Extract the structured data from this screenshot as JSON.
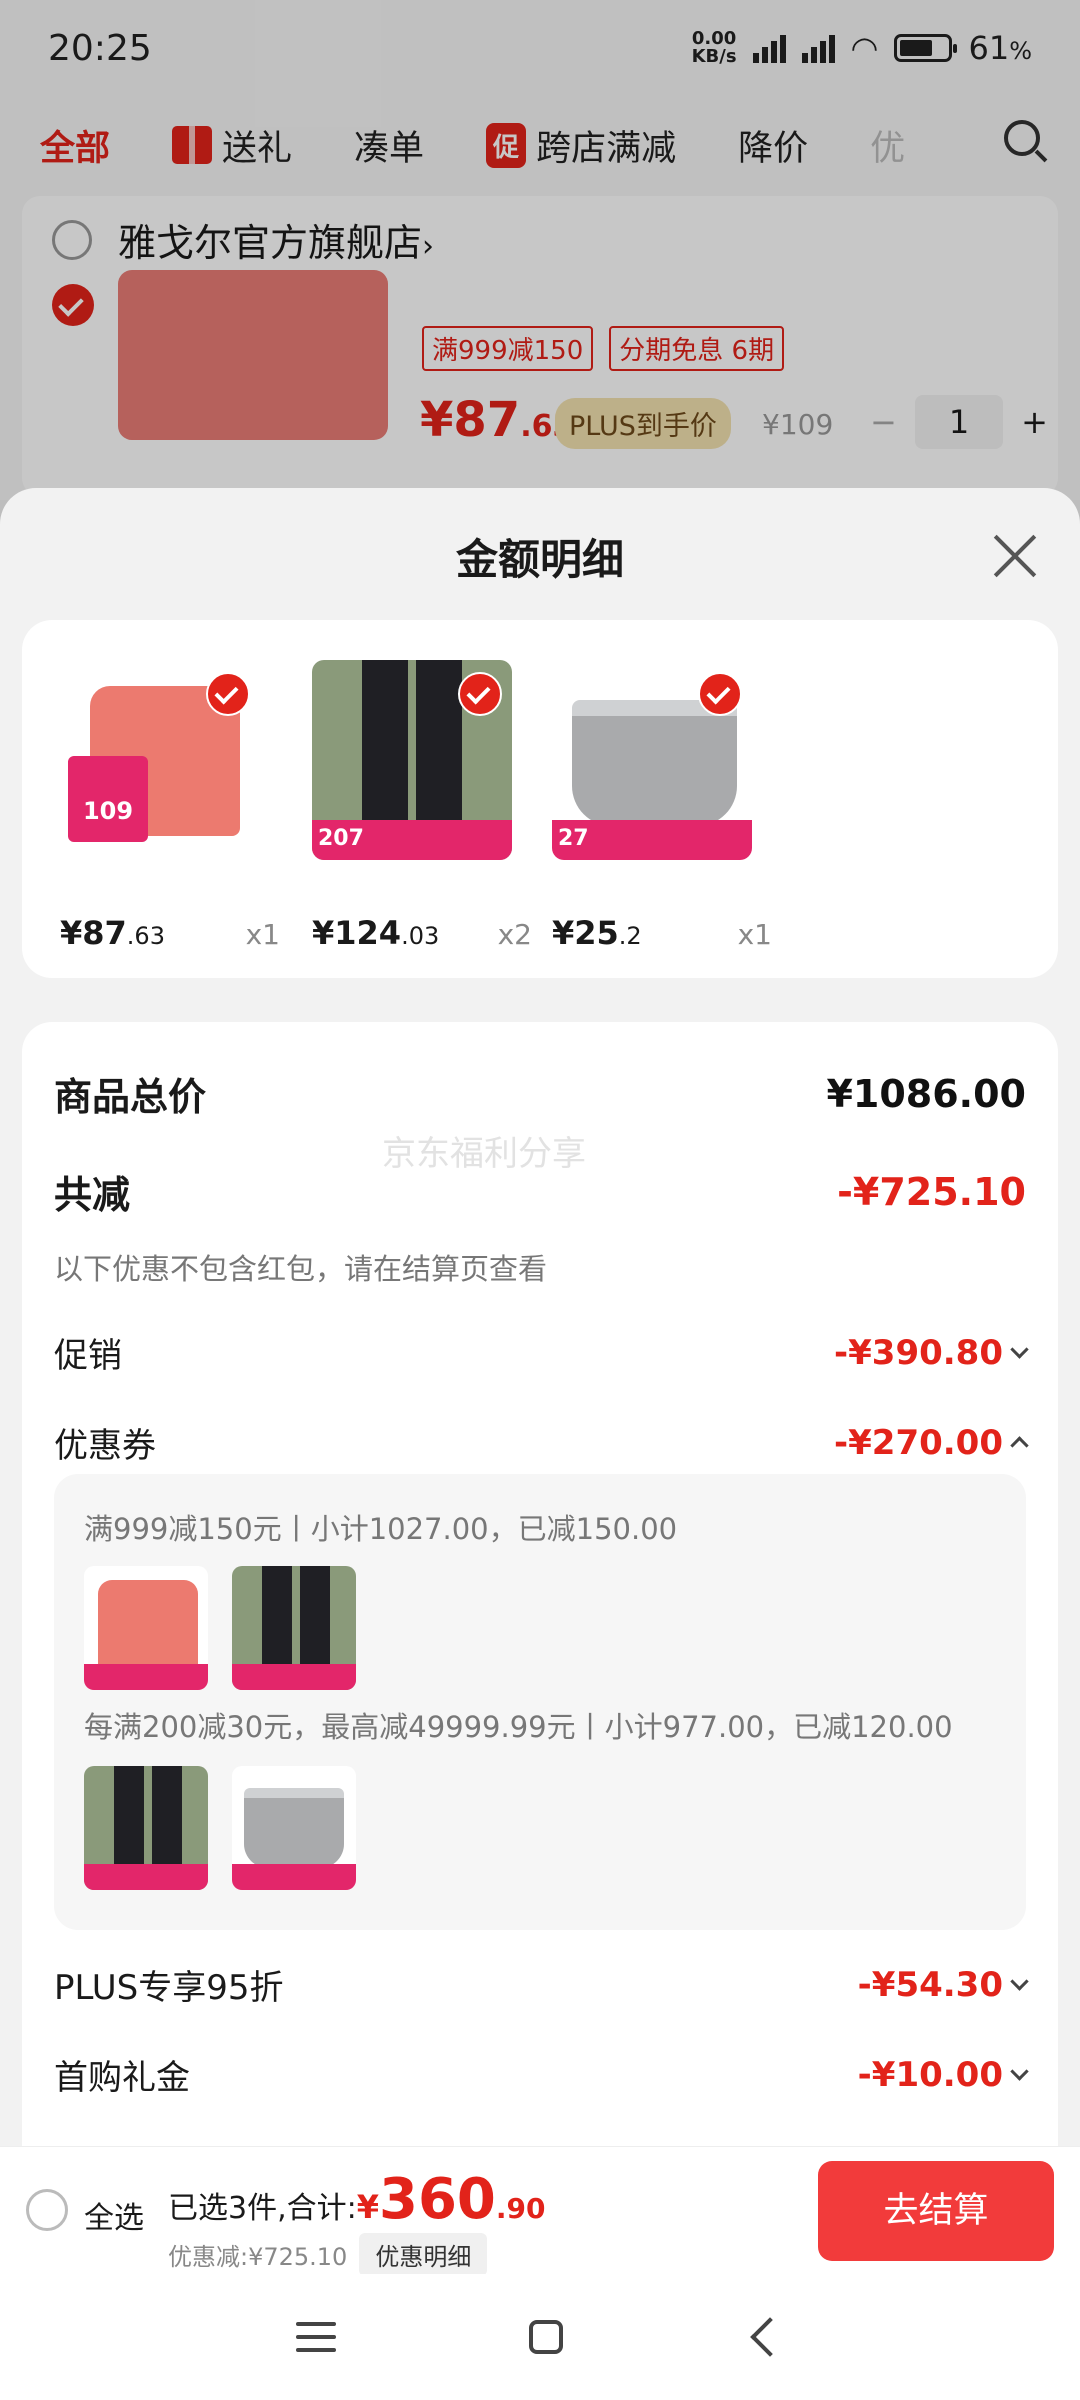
{
  "status": {
    "time": "20:25",
    "net_speed_top": "0.00",
    "net_speed_bottom": "KB/s",
    "battery": "61",
    "battery_unit": "%"
  },
  "tabs": [
    {
      "label": "全部"
    },
    {
      "label": "送礼"
    },
    {
      "label": "凑单"
    },
    {
      "label": "跨店满减",
      "badge": "促"
    },
    {
      "label": "降价"
    },
    {
      "label": "优"
    }
  ],
  "background_cart": {
    "store_name": "雅戈尔官方旗舰店",
    "store_chevron": "›",
    "tag1": "满999减150",
    "tag2_a": "分期免息",
    "tag2_b": "6期",
    "price_int": "¥87",
    "price_dec": ".63",
    "plus_label": "PLUS到手价",
    "orig_price": "¥109",
    "qty": "1",
    "minus": "−",
    "plus": "+"
  },
  "sheet": {
    "title": "金额明细",
    "products": [
      {
        "price_int": "¥87",
        "price_dec": ".63",
        "qty": "x1",
        "badge": "109",
        "type": "tshirt"
      },
      {
        "price_int": "¥124",
        "price_dec": ".03",
        "qty": "x2",
        "badge": "207",
        "type": "pants"
      },
      {
        "price_int": "¥25",
        "price_dec": ".2",
        "qty": "x1",
        "badge": "27",
        "type": "shorts"
      }
    ],
    "summary": {
      "total_label": "商品总价",
      "total_value": "¥1086.00",
      "watermark": "京东福利分享",
      "reduce_label": "共减",
      "reduce_value": "-¥725.10",
      "note": "以下优惠不包含红包，请在结算页查看",
      "promo_label": "促销",
      "promo_value": "-¥390.80",
      "coupon_label": "优惠券",
      "coupon_value": "-¥270.00",
      "coupon_line1": "满999减150元丨小计1027.00，已减150.00",
      "coupon_line2": "每满200减30元，最高减49999.99元丨小计977.00，已减120.00",
      "plus_label": "PLUS专享95折",
      "plus_value": "-¥54.30",
      "gift_label": "首购礼金",
      "gift_value": "-¥10.00"
    }
  },
  "bottom": {
    "select_all": "全选",
    "selected_text": "已选3件,合计:",
    "yen": "¥",
    "total_int": "360",
    "total_dec": ".90",
    "discount_text": "优惠减:¥725.10",
    "discount_btn": "优惠明细",
    "checkout": "去结算"
  },
  "colors": {
    "accent": "#e2231a",
    "checkout": "#f23b3b"
  }
}
